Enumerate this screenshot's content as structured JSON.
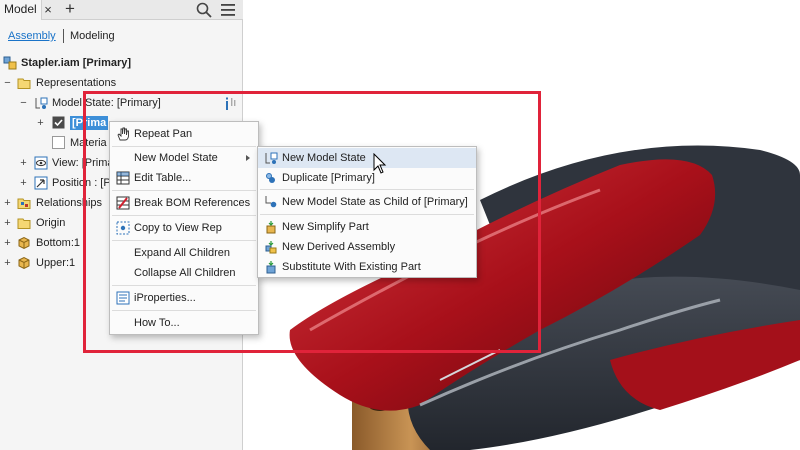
{
  "panel": {
    "tab_label": "Model",
    "close_glyph": "×",
    "add_glyph": "+",
    "mode_assembly": "Assembly",
    "mode_modeling": "Modeling"
  },
  "tree": {
    "root": "Stapler.iam [Primary]",
    "representations": "Representations",
    "model_state": "Model State: [Primary]",
    "primary": "[Prima",
    "material": "Materia",
    "view": "View: [Prima",
    "position": "Position : [P",
    "relationships": "Relationships",
    "origin": "Origin",
    "bottom": "Bottom:1",
    "upper": "Upper:1"
  },
  "context_menu": {
    "repeat_pan": "Repeat Pan",
    "new_model_state": "New Model State",
    "edit_table": "Edit Table...",
    "break_bom": "Break BOM References",
    "copy_view_rep": "Copy to View Rep",
    "expand_all": "Expand All Children",
    "collapse_all": "Collapse All Children",
    "iproperties": "iProperties...",
    "how_to": "How To..."
  },
  "submenu": {
    "new_model_state": "New Model State",
    "duplicate": "Duplicate [Primary]",
    "new_child": "New Model State as Child of [Primary]",
    "simplify": "New Simplify Part",
    "derived": "New Derived Assembly",
    "substitute": "Substitute With Existing Part"
  },
  "icons": [
    "close-icon",
    "add-icon",
    "search-icon",
    "hamburger-menu-icon",
    "assembly-icon",
    "folder-icon",
    "model-state-icon",
    "checkbox-icon",
    "view-icon",
    "position-icon",
    "relationships-icon",
    "origin-folder-icon",
    "part-icon",
    "hand-pan-icon",
    "table-icon",
    "break-bom-icon",
    "copy-view-icon",
    "iproperties-icon",
    "cursor-icon"
  ],
  "colors": {
    "accent": "#1a73c8",
    "selection": "#3d8fd8",
    "highlight_frame": "#e0233a",
    "stapler_red": "#b5121b",
    "stapler_dark": "#3a3f4a"
  }
}
